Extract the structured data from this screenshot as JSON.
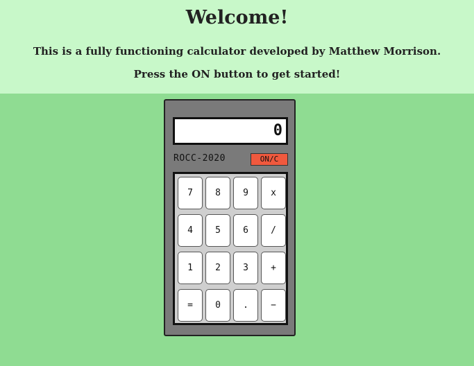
{
  "header": {
    "title": "Welcome!",
    "line1": "This is a fully functioning calculator developed by Matthew Morrison.",
    "line2": "Press the ON button to get started!"
  },
  "calculator": {
    "display_value": "0",
    "brand": "ROCC-2020",
    "on_button_label": "ON/C",
    "keys": [
      "7",
      "8",
      "9",
      "x",
      "4",
      "5",
      "6",
      "/",
      "1",
      "2",
      "3",
      "+",
      "=",
      "0",
      ".",
      "−"
    ]
  },
  "colors": {
    "page_bg": "#8fdc92",
    "banner_bg": "#c8f8c9",
    "calc_body": "#7a7a7a",
    "on_button": "#f0593e"
  }
}
